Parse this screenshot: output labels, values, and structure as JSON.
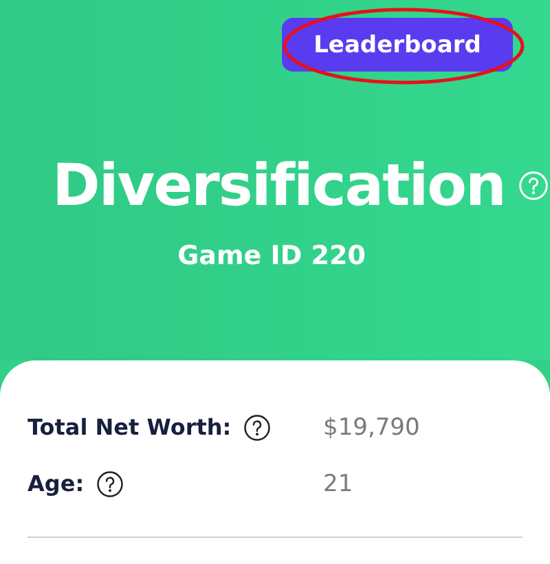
{
  "header": {
    "button": "Leaderboard",
    "title": "Diversification",
    "subtitle": "Game ID 220"
  },
  "stats": [
    {
      "label": "Total Net Worth:",
      "value": "$19,790"
    },
    {
      "label": "Age:",
      "value": "21"
    }
  ]
}
